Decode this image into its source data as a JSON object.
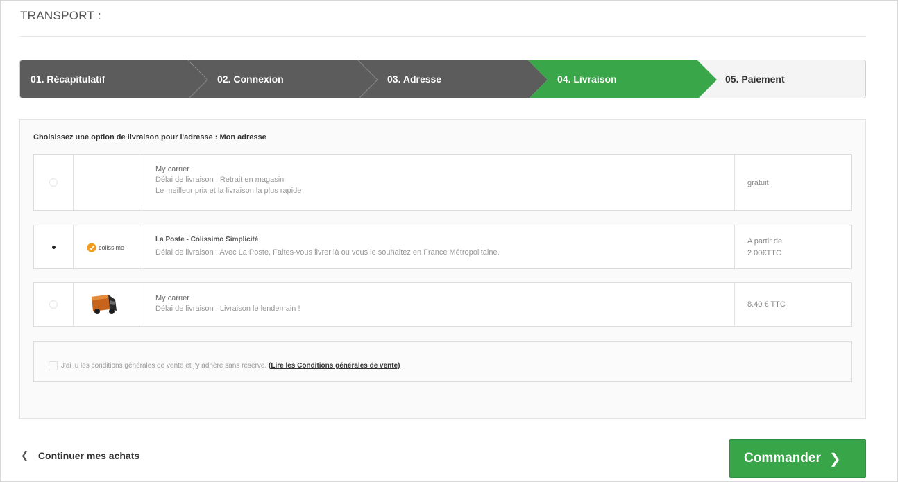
{
  "page": {
    "title": "TRANSPORT :"
  },
  "steps": [
    {
      "label": "01. Récapitulatif",
      "state": "done"
    },
    {
      "label": "02. Connexion",
      "state": "done"
    },
    {
      "label": "03. Adresse",
      "state": "done"
    },
    {
      "label": "04. Livraison",
      "state": "current"
    },
    {
      "label": "05. Paiement",
      "state": "todo"
    }
  ],
  "colors": {
    "done": "#5c5c5c",
    "current": "#3aa64a",
    "todo": "#f4f4f4",
    "button": "#37a548"
  },
  "delivery": {
    "address_label": "Choisissez une option de livraison pour l'adresse : Mon adresse",
    "options": [
      {
        "selected": false,
        "logo": "",
        "name": "My carrier",
        "lines": [
          "Délai de livraison : Retrait en magasin",
          "Le meilleur prix et la livraison la plus rapide"
        ],
        "price": "gratuit"
      },
      {
        "selected": true,
        "logo": "colissimo-logo",
        "logo_text": "colissimo",
        "name": "La Poste - Colissimo Simplicité",
        "lines": [
          "Délai de livraison : Avec La Poste, Faites-vous livrer là ou vous le souhaitez en France Métropolitaine."
        ],
        "price_line1": "A partir de",
        "price_line2": "2.00€TTC"
      },
      {
        "selected": false,
        "logo": "truck-icon",
        "name": "My carrier",
        "lines": [
          "Délai de livraison : Livraison le lendemain !"
        ],
        "price": "8.40 € TTC"
      }
    ]
  },
  "terms": {
    "text": "J'ai lu les conditions générales de vente et j'y adhère sans réserve.",
    "link": "(Lire les Conditions générales de vente)",
    "checked": false
  },
  "footer": {
    "continue_label": "Continuer mes achats",
    "order_label": "Commander"
  }
}
